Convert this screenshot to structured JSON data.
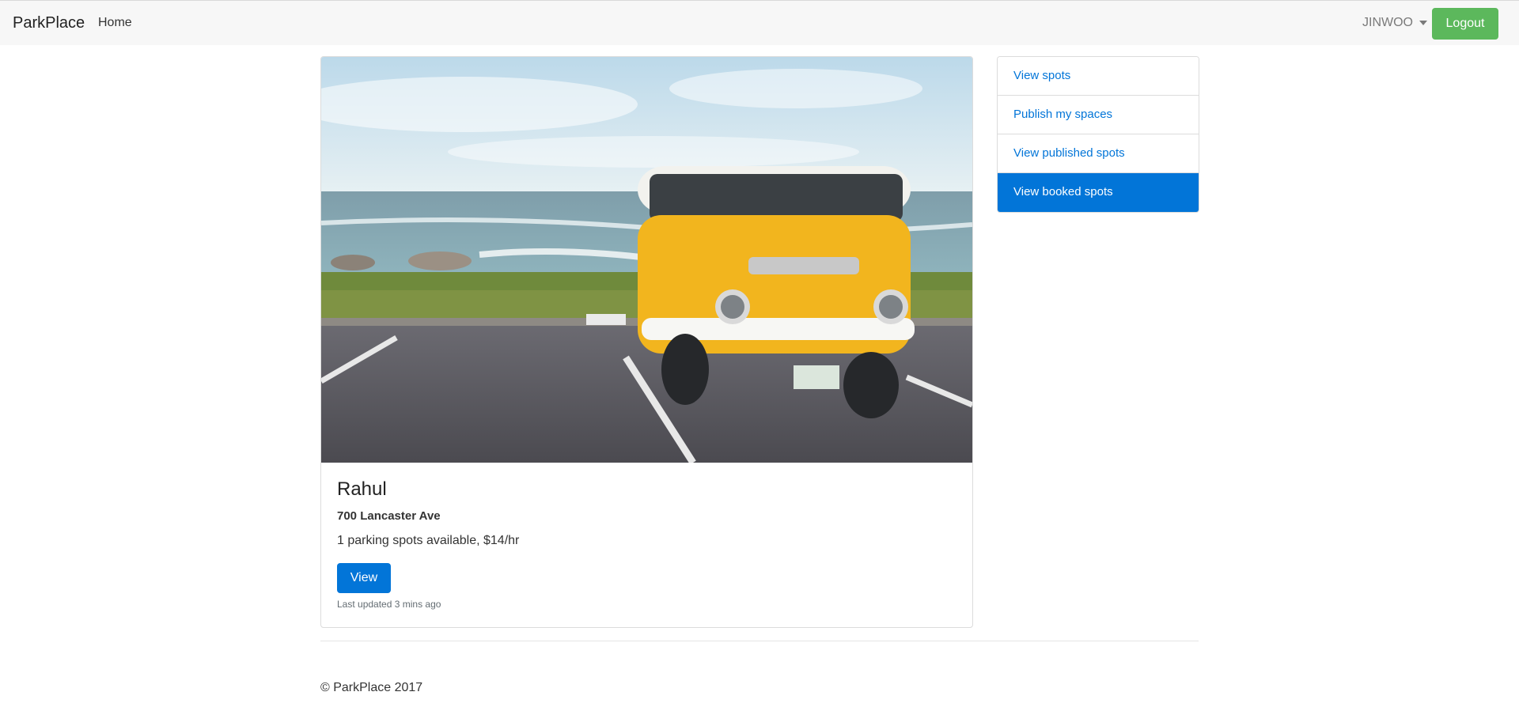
{
  "nav": {
    "brand": "ParkPlace",
    "home": "Home",
    "user": "JINWOO",
    "logout": "Logout"
  },
  "listing": {
    "title": "Rahul",
    "address": "700 Lancaster Ave",
    "info": "1 parking spots available, $14/hr",
    "view_label": "View",
    "updated": "Last updated 3 mins ago"
  },
  "sidebar": {
    "items": [
      {
        "label": "View spots",
        "active": false
      },
      {
        "label": "Publish my spaces",
        "active": false
      },
      {
        "label": "View published spots",
        "active": false
      },
      {
        "label": "View booked spots",
        "active": true
      }
    ]
  },
  "footer": {
    "text": "© ParkPlace 2017"
  },
  "colors": {
    "primary": "#0275d8",
    "success": "#5cb85c",
    "navbar_bg": "#f7f7f7"
  }
}
